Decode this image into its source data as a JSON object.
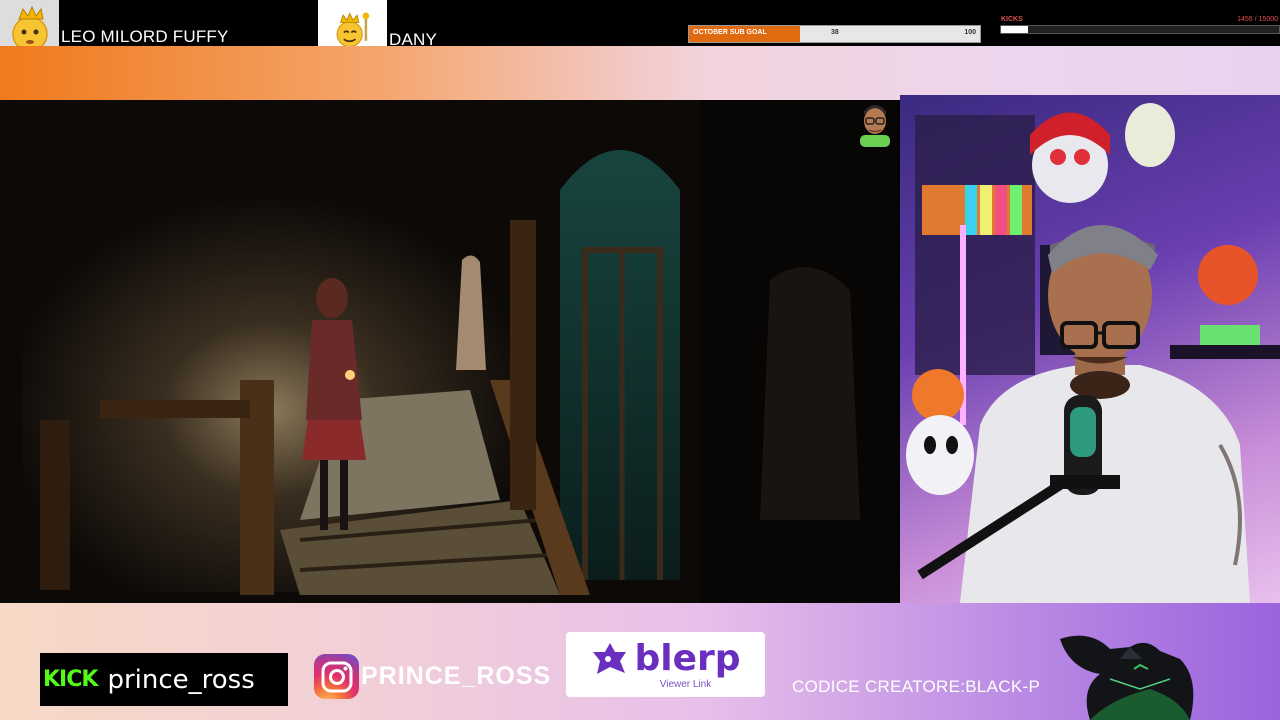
{
  "top_subs": [
    {
      "name": "LEO MILORD FUFFY",
      "avatar_icon": "crowned-emoji-icon"
    },
    {
      "name": "DANY",
      "avatar_icon": "king-emoji-icon"
    }
  ],
  "sub_goal": {
    "label": "OCTOBER SUB GOAL",
    "current": "38",
    "target": "100",
    "progress": 0.38,
    "color": "#e06a10"
  },
  "kicks_goal": {
    "label": "KICKS",
    "count": "1456 / 15000",
    "progress": 0.097
  },
  "bottom": {
    "kick_logo": "KICK",
    "kick_username": "prince_ross",
    "instagram_username": "PRINCE_ROSS",
    "blerp_name": "blerp",
    "blerp_sub": "Viewer Link",
    "creator_code": "CODICE CREATORE:BLACK-P"
  },
  "colors": {
    "kick_green": "#53fc18",
    "blerp_purple": "#6b2fc0",
    "accent_orange": "#f07a1c"
  }
}
